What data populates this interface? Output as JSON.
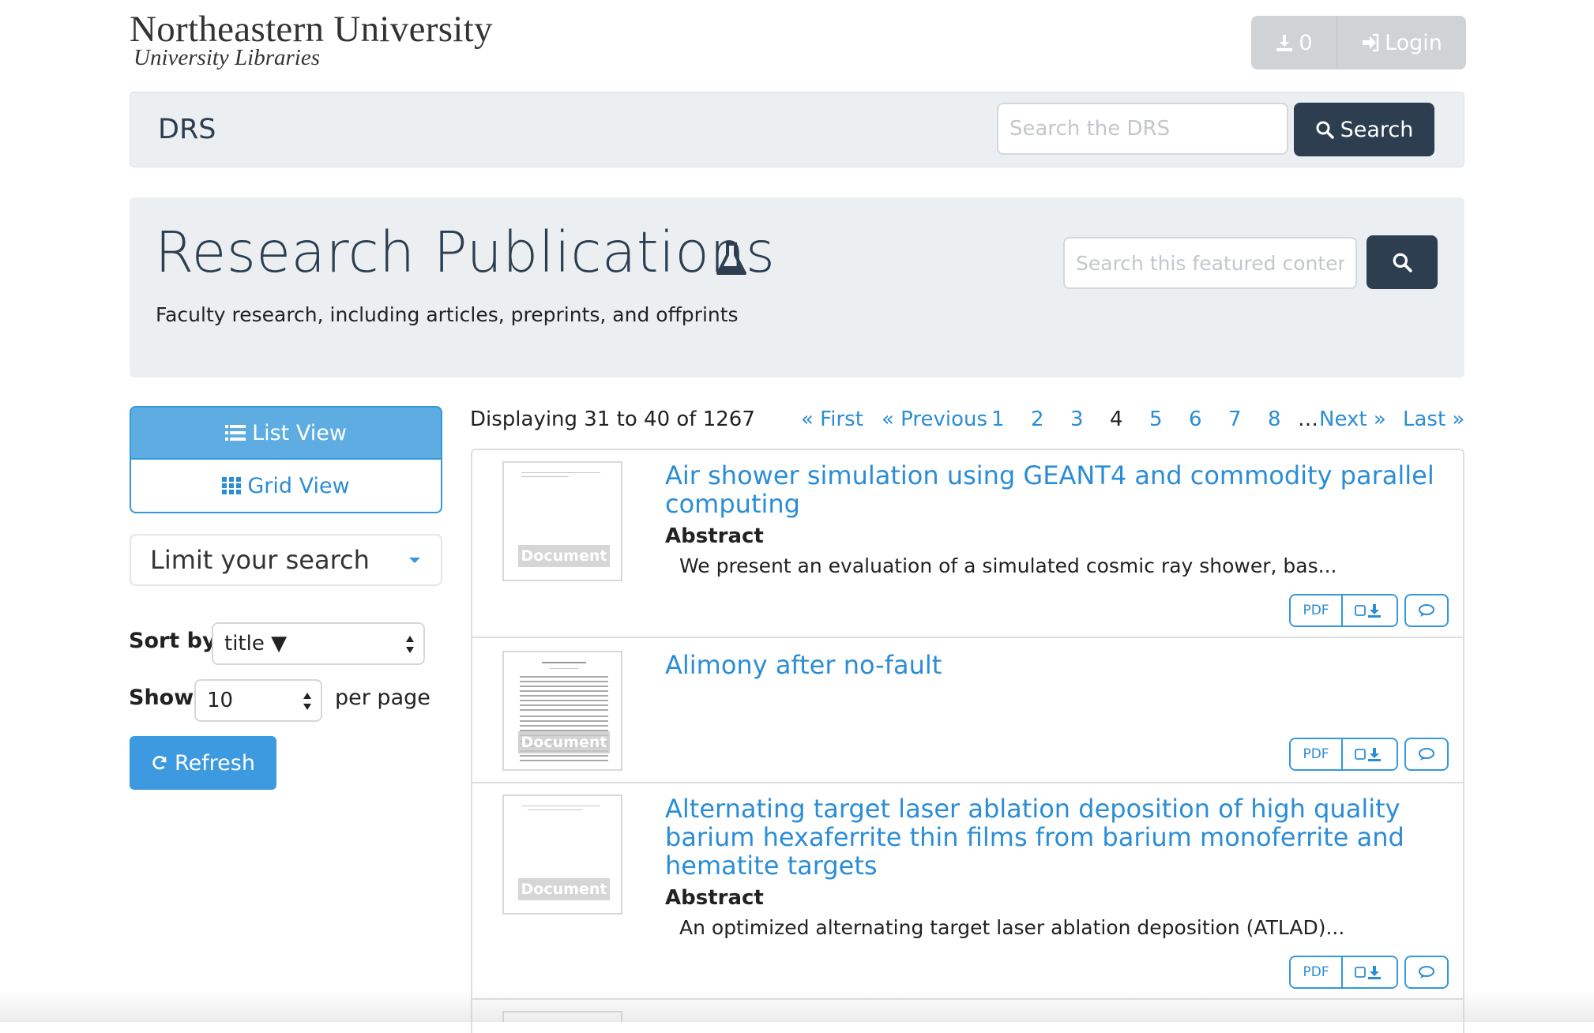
{
  "header": {
    "university": "Northeastern University",
    "libraries": "University Libraries",
    "download_count": "0",
    "login_label": "Login"
  },
  "navbar": {
    "title": "DRS",
    "search_placeholder": "Search the DRS",
    "search_button": "Search"
  },
  "collection": {
    "title": "Research Publications",
    "description": "Faculty research, including articles, preprints, and offprints",
    "search_placeholder": "Search this featured content"
  },
  "sidebar": {
    "list_view": "List View",
    "grid_view": "Grid View",
    "limit_search": "Limit your search",
    "sort_label": "Sort by",
    "sort_value": "title ▼",
    "show_label": "Show",
    "show_value": "10",
    "per_page": "per page",
    "refresh": "Refresh"
  },
  "results": {
    "displaying": "Displaying 31 to 40 of 1267",
    "pagination": {
      "first": "« First",
      "previous": "« Previous",
      "pages": [
        "1",
        "2",
        "3",
        "4",
        "5",
        "6",
        "7",
        "8"
      ],
      "current": "4",
      "ellipsis": "…",
      "next": "Next »",
      "last": "Last »"
    },
    "items": [
      {
        "title": "Air shower simulation using GEANT4 and commodity parallel computing",
        "has_abstract": true,
        "abstract_label": "Abstract",
        "abstract": "We present an evaluation of a simulated cosmic ray shower, bas..."
      },
      {
        "title": "Alimony after no-fault",
        "has_abstract": false
      },
      {
        "title": "Alternating target laser ablation deposition of high quality barium hexaferrite thin films from barium monoferrite and hematite targets",
        "has_abstract": true,
        "abstract_label": "Abstract",
        "abstract": "An optimized alternating target laser ablation deposition (ATLAD)..."
      }
    ],
    "thumb_label": "Document",
    "pdf_label": "PDF"
  },
  "colors": {
    "primary_dark": "#2c3e50",
    "link_blue": "#2b8dd6",
    "accent_blue": "#3498db",
    "light_bg": "#eceff1"
  }
}
